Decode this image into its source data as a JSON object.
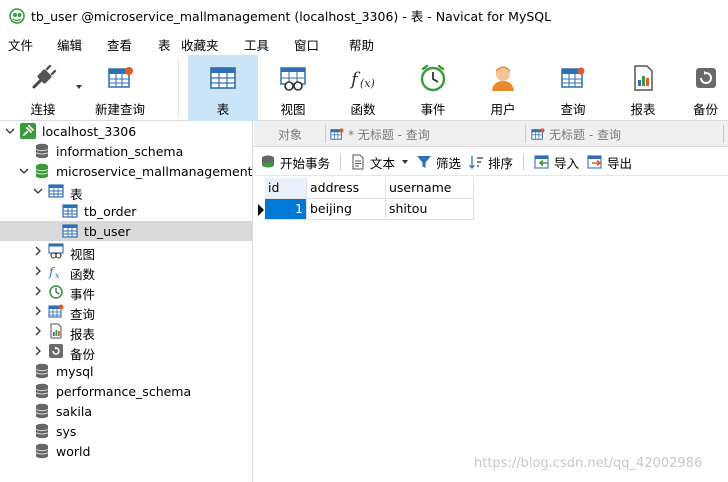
{
  "window": {
    "title": "tb_user @microservice_mallmanagement (localhost_3306) - 表 - Navicat for MySQL",
    "app_icon": "navicat-logo-icon"
  },
  "menu": [
    "文件",
    "编辑",
    "查看",
    "表",
    "收藏夹",
    "工具",
    "窗口",
    "帮助"
  ],
  "toolbar": {
    "connect": "连接",
    "new_query": "新建查询",
    "table": "表",
    "view": "视图",
    "function": "函数",
    "event": "事件",
    "user": "用户",
    "query": "查询",
    "report": "报表",
    "backup": "备份"
  },
  "tree": {
    "connection": "localhost_3306",
    "databases": [
      "information_schema",
      "microservice_mallmanagement",
      "mysql",
      "performance_schema",
      "sakila",
      "sys",
      "world"
    ],
    "tables_group": "表",
    "tables": [
      "tb_order",
      "tb_user"
    ],
    "selected_table": "tb_user",
    "groups": [
      "视图",
      "函数",
      "事件",
      "查询",
      "报表",
      "备份"
    ]
  },
  "tabs": {
    "objects": "对象",
    "tab1": "* 无标题 - 查询",
    "tab2": "无标题 - 查询"
  },
  "subtoolbar": {
    "begin_transaction": "开始事务",
    "text": "文本",
    "filter": "筛选",
    "sort": "排序",
    "import": "导入",
    "export": "导出"
  },
  "grid": {
    "columns": [
      "id",
      "address",
      "username"
    ],
    "rows": [
      [
        "1",
        "beijing",
        "shitou"
      ]
    ]
  },
  "watermark": "https://blog.csdn.net/qq_42002986",
  "colors": {
    "selection": "#0078d7",
    "toolbar_active": "#cce4f7",
    "tree_selected": "#d9d9d9",
    "db_icon": "#5a5a5a",
    "connection_green": "#3a9b3a"
  }
}
